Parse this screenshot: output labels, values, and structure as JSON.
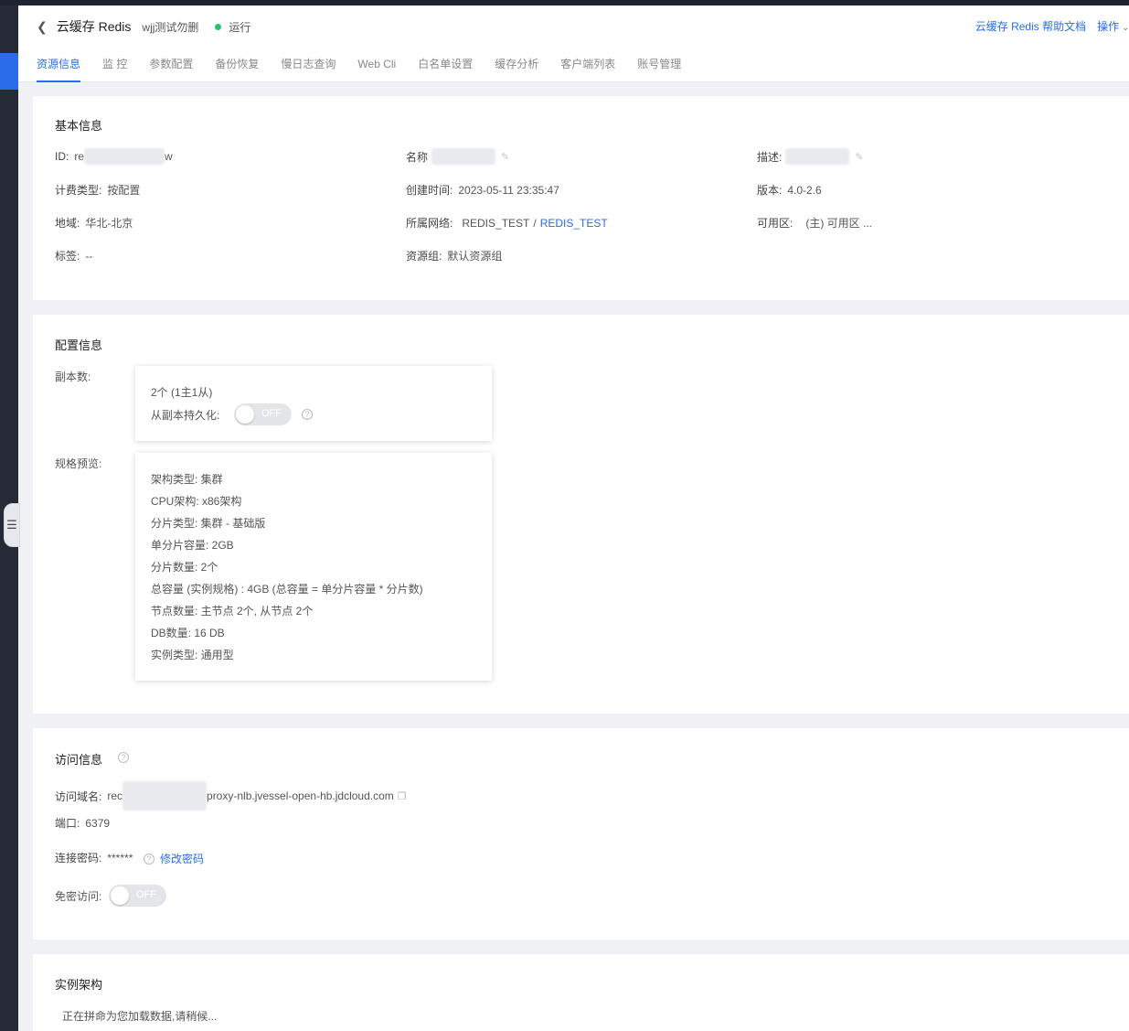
{
  "header": {
    "title": "云缓存 Redis",
    "instance_name": "wjj测试勿删",
    "status": "运行",
    "status_color": "#2bc06a",
    "help_link": "云缓存 Redis 帮助文档",
    "ops_menu": "操作"
  },
  "tabs": [
    {
      "label": "资源信息",
      "active": true
    },
    {
      "label": "监 控"
    },
    {
      "label": "参数配置"
    },
    {
      "label": "备份恢复"
    },
    {
      "label": "慢日志查询"
    },
    {
      "label": "Web Cli"
    },
    {
      "label": "白名单设置"
    },
    {
      "label": "缓存分析"
    },
    {
      "label": "客户端列表"
    },
    {
      "label": "账号管理"
    }
  ],
  "basic": {
    "title": "基本信息",
    "id_label": "ID:",
    "id_prefix": "re",
    "id_suffix": "w",
    "name_label": "名称",
    "desc_label": "描述:",
    "billing_label": "计费类型:",
    "billing_value": "按配置",
    "created_label": "创建时间:",
    "created_value": "2023-05-11 23:35:47",
    "version_label": "版本:",
    "version_value": "4.0-2.6",
    "region_label": "地域:",
    "region_value": "华北-北京",
    "vpc_label": "所属网络:",
    "vpc_value_1": "REDIS_TEST",
    "vpc_sep": "/",
    "vpc_value_2": "REDIS_TEST",
    "az_label": "可用区:",
    "az_value": "(主) 可用区 ...",
    "tag_label": "标签:",
    "tag_value": "--",
    "rg_label": "资源组:",
    "rg_value": "默认资源组"
  },
  "config": {
    "title": "配置信息",
    "replica_label": "副本数:",
    "replica_value": "2个 (1主1从)",
    "persist_label": "从副本持久化:",
    "persist_toggle": "OFF",
    "spec_label": "规格预览:",
    "spec_lines": [
      "架构类型: 集群",
      "CPU架构: x86架构",
      "分片类型: 集群 - 基础版",
      "单分片容量: 2GB",
      "分片数量: 2个",
      "总容量 (实例规格) : 4GB (总容量 = 单分片容量 * 分片数)",
      "节点数量: 主节点 2个, 从节点 2个",
      "DB数量: 16 DB",
      "实例类型: 通用型"
    ]
  },
  "access": {
    "title": "访问信息",
    "domain_label": "访问域名:",
    "domain_prefix": "rec",
    "domain_suffix": "proxy-nlb.jvessel-open-hb.jdcloud.com",
    "port_label": "端口:",
    "port_value": "6379",
    "password_label": "连接密码:",
    "password_value": "******",
    "change_password": "修改密码",
    "nopass_label": "免密访问:",
    "nopass_toggle": "OFF"
  },
  "arch": {
    "title": "实例架构",
    "loading_text": "正在拼命为您加载数据,请稍候..."
  }
}
